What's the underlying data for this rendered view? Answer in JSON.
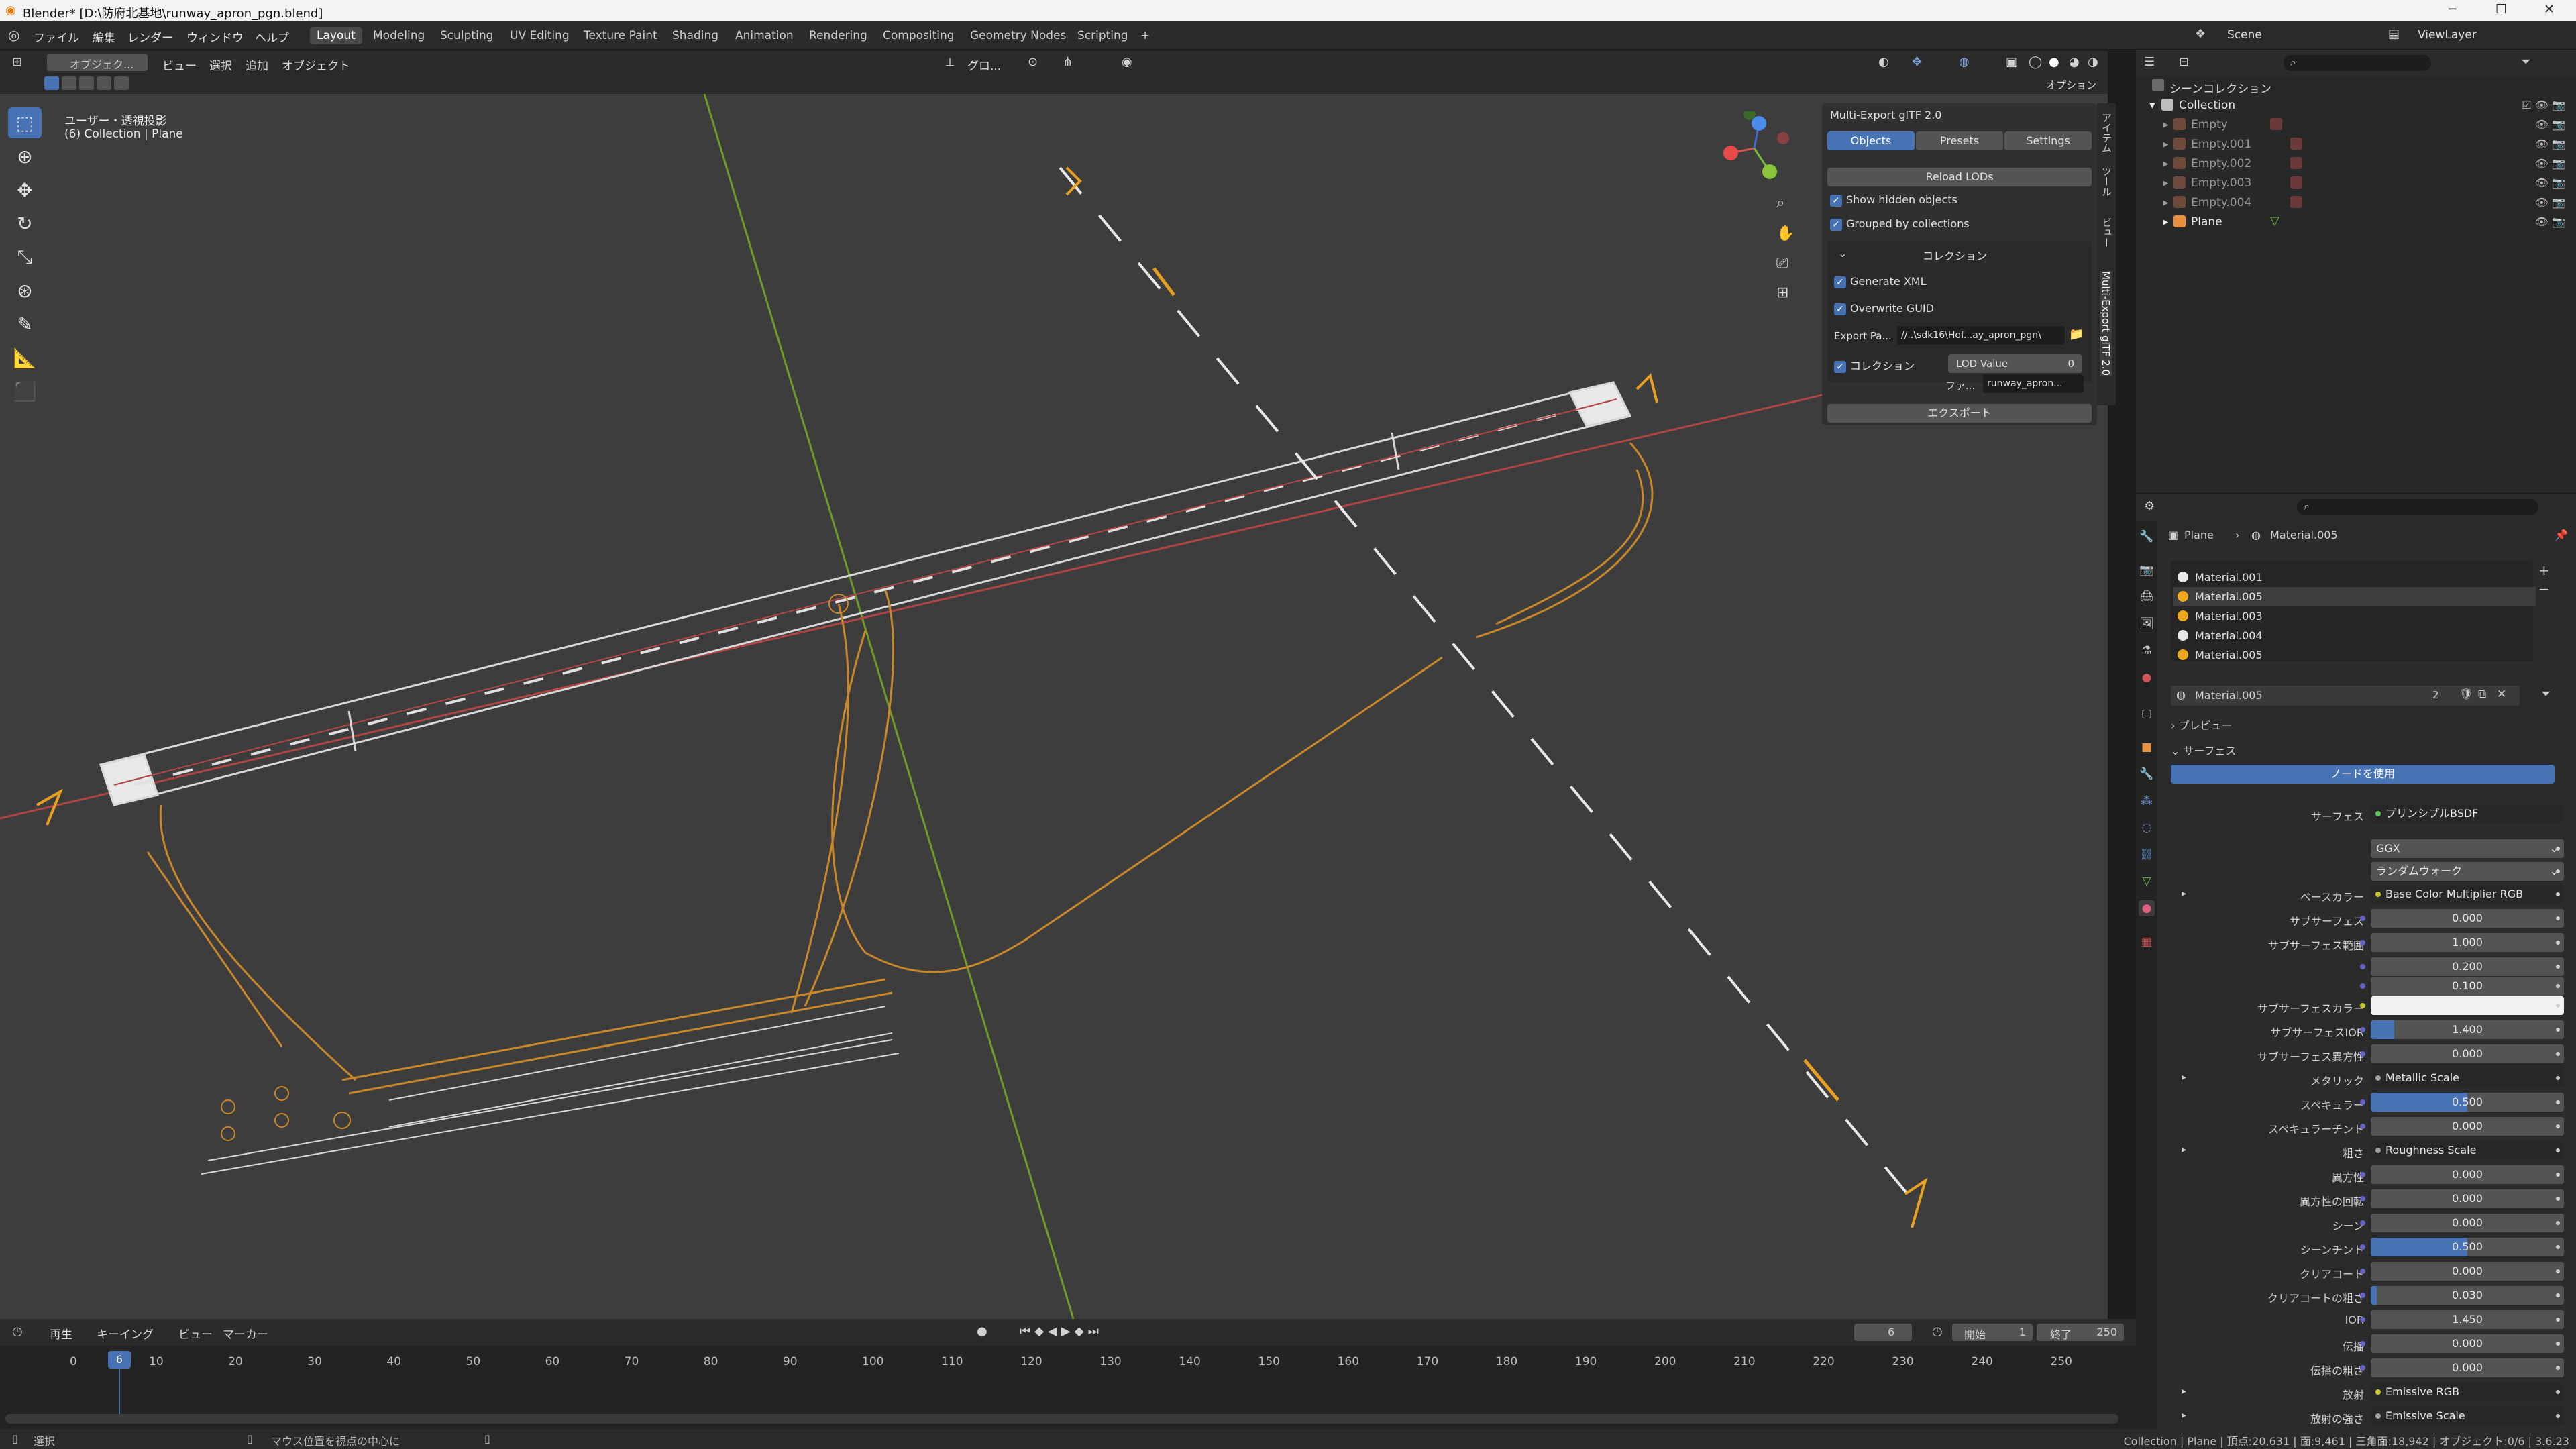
{
  "window": {
    "title": "Blender* [D:\\防府北基地\\runway_apron_pgn.blend]",
    "controls": [
      "─",
      "☐",
      "✕"
    ]
  },
  "menu": {
    "items": [
      "ファイル",
      "編集",
      "レンダー",
      "ウィンドウ",
      "ヘルプ"
    ],
    "workspaces": [
      "Layout",
      "Modeling",
      "Sculpting",
      "UV Editing",
      "Texture Paint",
      "Shading",
      "Animation",
      "Rendering",
      "Compositing",
      "Geometry Nodes",
      "Scripting",
      "+"
    ],
    "active_workspace": "Layout",
    "scene_label": "Scene",
    "viewlayer_label": "ViewLayer"
  },
  "viewport_header": {
    "mode": "オブジェク...",
    "menus": [
      "ビュー",
      "選択",
      "追加",
      "オブジェクト"
    ],
    "transform": "グロ...",
    "options": "オプション"
  },
  "viewport": {
    "view_name": "ユーザー・透視投影",
    "collection_info": "(6) Collection | Plane",
    "tools": [
      "select-box-icon",
      "cursor-icon",
      "move-icon",
      "rotate-icon",
      "scale-icon",
      "transform-icon",
      "annotate-icon",
      "measure-icon",
      "add-cube-icon"
    ]
  },
  "multi_export": {
    "title": "Multi-Export glTF 2.0",
    "tabs": [
      "Objects",
      "Presets",
      "Settings"
    ],
    "active_tab": "Objects",
    "reload_lods": "Reload LODs",
    "show_hidden": "Show hidden objects",
    "grouped": "Grouped by collections",
    "collection_header": "コレクション",
    "generate_xml": "Generate XML",
    "overwrite_guid": "Overwrite GUID",
    "export_path_label": "Export Pa...",
    "export_path_value": "//..\\sdk16\\Hof...ay_apron_pgn\\",
    "collection_check": "コレクション",
    "lod_label": "LOD Value",
    "lod_value": "0",
    "file_label": "ファ...",
    "file_value": "runway_apron...",
    "export_button": "エクスポート"
  },
  "side_tabs": [
    "アイテム",
    "ツール",
    "ビュー",
    "Multi-Export glTF 2.0"
  ],
  "outliner": {
    "root": "シーンコレクション",
    "collection": "Collection",
    "items": [
      "Empty",
      "Empty.001",
      "Empty.002",
      "Empty.003",
      "Empty.004",
      "Plane"
    ]
  },
  "properties": {
    "breadcrumb_object": "Plane",
    "breadcrumb_material": "Material.005",
    "materials": [
      {
        "name": "Material.001",
        "color": "#e8e8e8"
      },
      {
        "name": "Material.005",
        "color": "#f0a818"
      },
      {
        "name": "Material.003",
        "color": "#f0a818"
      },
      {
        "name": "Material.004",
        "color": "#e8e8e8"
      },
      {
        "name": "Material.005",
        "color": "#f0a818"
      }
    ],
    "active_material": "Material.005",
    "user_count": "2",
    "preview_label": "プレビュー",
    "surface_label": "サーフェス",
    "use_nodes": "ノードを使用",
    "surface_field_label": "サーフェス",
    "surface_field_value": "プリンシプルBSDF",
    "distribution": "GGX",
    "subsurface_method": "ランダムウォーク",
    "rows": [
      {
        "label": "ベースカラー",
        "type": "node",
        "value": "Base Color Multiplier RGB",
        "dot": "#c7c729"
      },
      {
        "label": "サブサーフェス",
        "type": "num",
        "value": "0.000",
        "fill": 0
      },
      {
        "label": "サブサーフェス範囲",
        "type": "num",
        "value": "1.000",
        "fill": 0
      },
      {
        "label": "",
        "type": "num",
        "value": "0.200",
        "fill": 0
      },
      {
        "label": "",
        "type": "num",
        "value": "0.100",
        "fill": 0
      },
      {
        "label": "サブサーフェスカラー",
        "type": "color",
        "value": "",
        "dot": "#c7c729"
      },
      {
        "label": "サブサーフェスIOR",
        "type": "num",
        "value": "1.400",
        "fill": 0.12
      },
      {
        "label": "サブサーフェス異方性",
        "type": "num",
        "value": "0.000",
        "fill": 0
      },
      {
        "label": "メタリック",
        "type": "node",
        "value": "Metallic Scale",
        "dot": "#a1a1a1"
      },
      {
        "label": "スペキュラー",
        "type": "num",
        "value": "0.500",
        "fill": 0.5
      },
      {
        "label": "スペキュラーチント",
        "type": "num",
        "value": "0.000",
        "fill": 0
      },
      {
        "label": "粗さ",
        "type": "node",
        "value": "Roughness Scale",
        "dot": "#a1a1a1"
      },
      {
        "label": "異方性",
        "type": "num",
        "value": "0.000",
        "fill": 0
      },
      {
        "label": "異方性の回転",
        "type": "num",
        "value": "0.000",
        "fill": 0
      },
      {
        "label": "シーン",
        "type": "num",
        "value": "0.000",
        "fill": 0
      },
      {
        "label": "シーンチント",
        "type": "num",
        "value": "0.500",
        "fill": 0.5
      },
      {
        "label": "クリアコート",
        "type": "num",
        "value": "0.000",
        "fill": 0
      },
      {
        "label": "クリアコートの粗さ",
        "type": "num",
        "value": "0.030",
        "fill": 0.03
      },
      {
        "label": "IOR",
        "type": "num",
        "value": "1.450",
        "fill": 0
      },
      {
        "label": "伝播",
        "type": "num",
        "value": "0.000",
        "fill": 0
      },
      {
        "label": "伝播の粗さ",
        "type": "num",
        "value": "0.000",
        "fill": 0
      },
      {
        "label": "放射",
        "type": "node",
        "value": "Emissive RGB",
        "dot": "#c7c729"
      },
      {
        "label": "放射の強さ",
        "type": "node",
        "value": "Emissive Scale",
        "dot": "#a1a1a1"
      }
    ]
  },
  "timeline": {
    "menus": [
      "再生",
      "キーイング",
      "ビュー",
      "マーカー"
    ],
    "current_frame": "6",
    "start_label": "開始",
    "start": "1",
    "end_label": "終了",
    "end": "250",
    "ticks": [
      "0",
      "10",
      "20",
      "30",
      "40",
      "50",
      "60",
      "70",
      "80",
      "90",
      "100",
      "110",
      "120",
      "130",
      "140",
      "150",
      "160",
      "170",
      "180",
      "190",
      "200",
      "210",
      "220",
      "230",
      "240",
      "250"
    ],
    "playhead": "6"
  },
  "status": {
    "select": "選択",
    "hint": "マウス位置を視点の中心に",
    "stats": "Collection | Plane | 頂点:20,631 | 面:9,461 | 三角面:18,942 | オブジェクト:0/6 | 3.6.23"
  },
  "colors": {
    "accent": "#4772b3",
    "apron_line": "#c8882a",
    "grid_axis_red": "#b04545",
    "grid_axis_green": "#6e9a28"
  }
}
